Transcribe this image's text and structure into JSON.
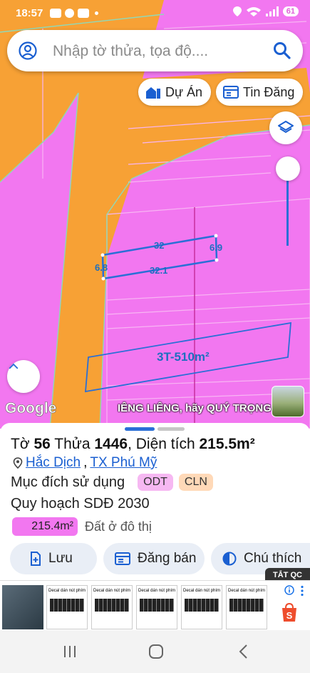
{
  "status_bar": {
    "time": "18:57",
    "battery": "61"
  },
  "search": {
    "placeholder": "Nhập tờ thửa, tọa độ...."
  },
  "top_buttons": {
    "project_label": "Dự Án",
    "listing_label": "Tin Đăng"
  },
  "map": {
    "dims": {
      "top": "32",
      "right": "6.9",
      "left": "6.8",
      "bottom": "32.1"
    },
    "zone_label": "3T-510m²",
    "provider": "Google",
    "banner": "IÊNG LIÊNG, hãy QUÝ TRỌNG"
  },
  "parcel": {
    "to_label": "Tờ",
    "to_value": "56",
    "thua_label": "Thửa",
    "thua_value": "1446",
    "area_label": ", Diện tích",
    "area_value": "215.5m²",
    "commune": "Hắc Dịch",
    "separator": ",",
    "town": "TX Phú Mỹ",
    "purpose_label": "Mục đích sử dụng",
    "purpose_tags": [
      "ODT",
      "CLN"
    ],
    "plan_label": "Quy hoạch SDĐ 2030",
    "plan_area": "215.4m²",
    "plan_desc": "Đất ở đô thị"
  },
  "actions": {
    "save": "Lưu",
    "post": "Đăng bán",
    "legend": "Chú thích"
  },
  "ad": {
    "close_label": "TẮT QC",
    "card_title": "Decal dán nút phím"
  },
  "colors": {
    "zone_pink": "#f277f0",
    "road_orange": "#f7a135",
    "accent_blue": "#1a5fd1",
    "tag_odt": "#f6b8f2",
    "tag_cln": "#ffd9b8"
  }
}
